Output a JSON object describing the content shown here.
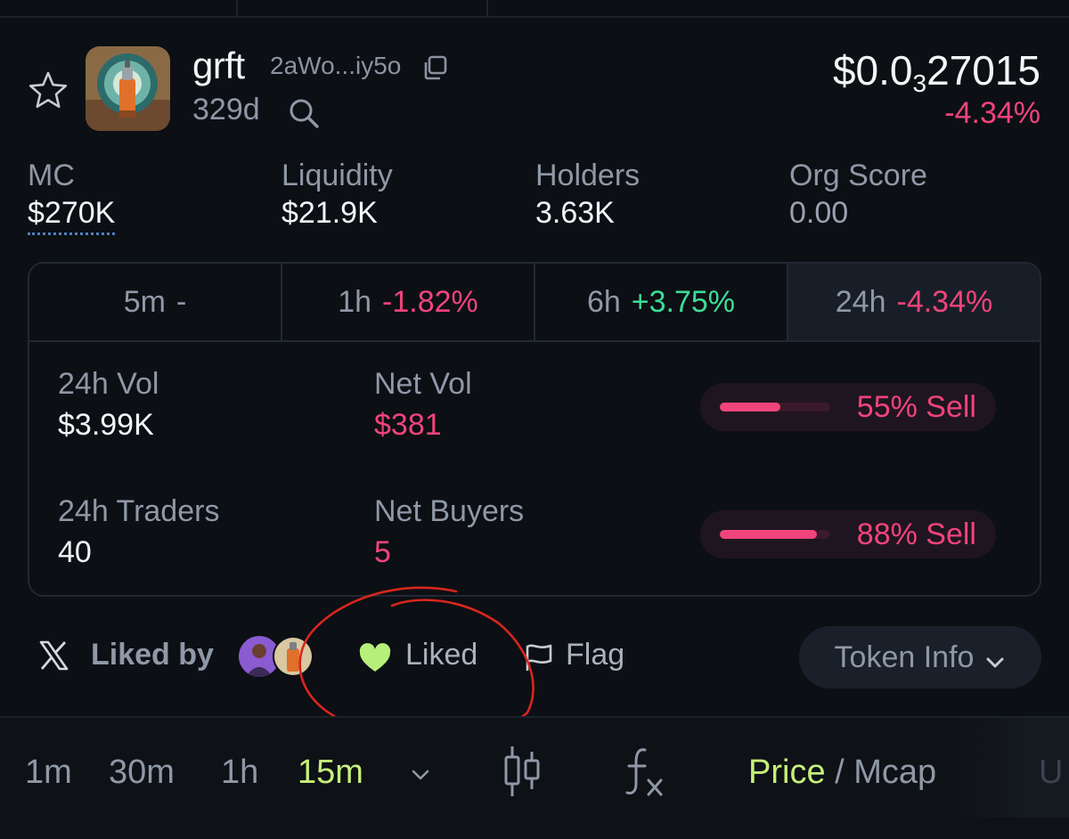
{
  "token": {
    "name": "grft",
    "address_short": "2aWo...iy5o",
    "age": "329d",
    "price_prefix": "$0.0",
    "price_zero_count": "3",
    "price_digits": "27015",
    "price_change": "-4.34%"
  },
  "stats": [
    {
      "label": "MC",
      "value": "$270K"
    },
    {
      "label": "Liquidity",
      "value": "$21.9K"
    },
    {
      "label": "Holders",
      "value": "3.63K"
    },
    {
      "label": "Org Score",
      "value": "0.00"
    }
  ],
  "timeframes": [
    {
      "label": "5m",
      "change": "-"
    },
    {
      "label": "1h",
      "change": "-1.82%"
    },
    {
      "label": "6h",
      "change": "+3.75%"
    },
    {
      "label": "24h",
      "change": "-4.34%",
      "selected": true
    }
  ],
  "metrics": {
    "vol_label": "24h Vol",
    "vol_value": "$3.99K",
    "net_vol_label": "Net Vol",
    "net_vol_value": "$381",
    "vol_ratio_text": "55% Sell",
    "vol_sell_fraction": 0.55,
    "traders_label": "24h Traders",
    "traders_value": "40",
    "net_buyers_label": "Net Buyers",
    "net_buyers_value": "5",
    "traders_ratio_text": "88% Sell",
    "traders_sell_fraction": 0.88
  },
  "social": {
    "liked_by_label": "Liked by",
    "liked_label": "Liked",
    "flag_label": "Flag",
    "token_info_label": "Token Info"
  },
  "toolbar": {
    "intervals": [
      "1m",
      "30m",
      "1h",
      "15m"
    ],
    "active_interval": "15m",
    "price_label": "Price",
    "separator": "/",
    "mcap_label": "Mcap",
    "cut_label": "U"
  },
  "colors": {
    "background": "#0c0f14",
    "negative": "#f0447a",
    "positive": "#3ddc97",
    "accent_green": "#c5f07a",
    "liked_heart": "#b6f07a"
  },
  "icons": [
    "star-icon",
    "copy-icon",
    "search-icon",
    "x-logo-icon",
    "heart-icon",
    "flag-icon",
    "chevron-down-icon",
    "candlestick-icon",
    "function-icon"
  ]
}
